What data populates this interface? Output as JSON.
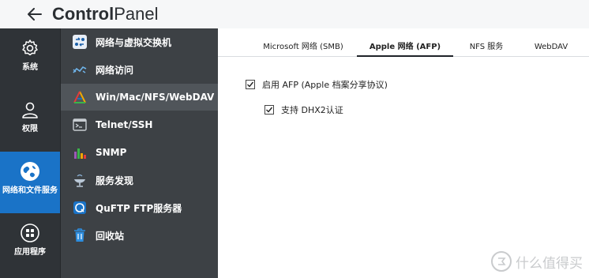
{
  "header": {
    "title_bold": "Control",
    "title_light": "Panel"
  },
  "categories": [
    {
      "id": "system",
      "label": "系统",
      "icon": "gear-icon",
      "active": false
    },
    {
      "id": "privilege",
      "label": "权限",
      "icon": "user-icon",
      "active": false
    },
    {
      "id": "network",
      "label": "网络和文件服务",
      "icon": "globe-icon",
      "active": true
    },
    {
      "id": "apps",
      "label": "应用程序",
      "icon": "apps-grid-icon",
      "active": false
    }
  ],
  "submenu": [
    {
      "label": "网络与虚拟交换机",
      "icon": "virtual-switch-icon"
    },
    {
      "label": "网络访问",
      "icon": "network-access-icon"
    },
    {
      "label": "Win/Mac/NFS/WebDAV",
      "icon": "file-protocols-icon",
      "active": true
    },
    {
      "label": "Telnet/SSH",
      "icon": "terminal-icon"
    },
    {
      "label": "SNMP",
      "icon": "snmp-chart-icon"
    },
    {
      "label": "服务发现",
      "icon": "satellite-dish-icon"
    },
    {
      "label": "QuFTP FTP服务器",
      "icon": "ftp-icon"
    },
    {
      "label": "回收站",
      "icon": "recycle-bin-icon"
    }
  ],
  "tabs": [
    {
      "label": "Microsoft 网络 (SMB)",
      "active": false
    },
    {
      "label": "Apple 网络 (AFP)",
      "active": true
    },
    {
      "label": "NFS 服务",
      "active": false
    },
    {
      "label": "WebDAV",
      "active": false
    }
  ],
  "options": [
    {
      "label": "启用 AFP (Apple 档案分享协议)",
      "checked": true
    },
    {
      "label": "支持 DHX2认证",
      "checked": true
    }
  ],
  "watermark": {
    "text": "什么值得买"
  },
  "colors": {
    "accent": "#1a73c7",
    "rail": "#2f3337",
    "submenu": "#3d4145",
    "submenu_active": "#50555a"
  }
}
